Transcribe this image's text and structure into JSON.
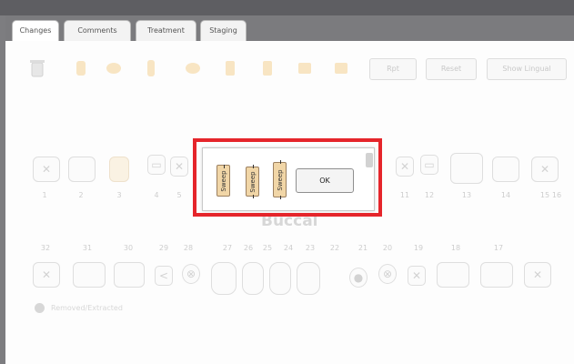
{
  "tabs": [
    {
      "label": "Changes",
      "active": true
    },
    {
      "label": "Comments",
      "active": false
    },
    {
      "label": "Treatment",
      "active": false
    },
    {
      "label": "Staging",
      "active": false
    }
  ],
  "toolbar": {
    "buttons": [
      "Rpt",
      "Reset",
      "Show Lingual"
    ]
  },
  "upper_numbers": [
    "1",
    "2",
    "3",
    "4",
    "5",
    "11",
    "12",
    "13",
    "14",
    "15",
    "16"
  ],
  "lower_numbers": [
    "32",
    "31",
    "30",
    "29",
    "28",
    "27",
    "26",
    "25",
    "24",
    "23",
    "22",
    "21",
    "20",
    "19",
    "18",
    "17"
  ],
  "region_label": "Buccal",
  "legend_text": "Removed/Extracted",
  "dialog": {
    "options": [
      "Sweep",
      "Sweep",
      "Sweep"
    ],
    "ok_label": "OK"
  },
  "colors": {
    "highlight": "#e5252b",
    "selected_tooth": "#f5dcae"
  }
}
